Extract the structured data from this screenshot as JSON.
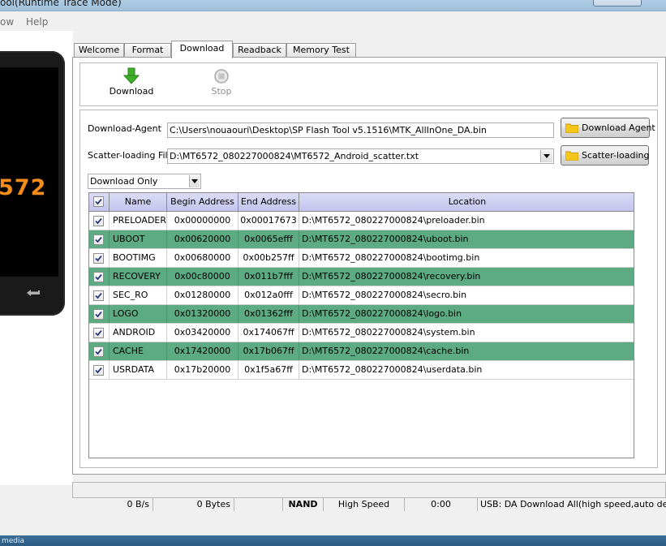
{
  "window": {
    "title": "ool(Runtime Trace Mode)"
  },
  "menu": [
    "ow",
    "Help"
  ],
  "phone": {
    "model_text": "572",
    "back_icon": "back-arrow-icon"
  },
  "tabs": [
    "Welcome",
    "Format",
    "Download",
    "Readback",
    "Memory Test"
  ],
  "active_tab": "Download",
  "toolbar": {
    "download_label": "Download",
    "stop_label": "Stop"
  },
  "download_agent": {
    "label": "Download-Agent",
    "path": "C:\\Users\\nouaouri\\Desktop\\SP Flash Tool v5.1516\\MTK_AllInOne_DA.bin",
    "button_label": "Download Agent"
  },
  "scatter": {
    "label": "Scatter-loading File",
    "path": "D:\\MT6572_080227000824\\MT6572_Android_scatter.txt",
    "button_label": "Scatter-loading"
  },
  "mode": {
    "selected": "Download Only"
  },
  "table": {
    "columns": [
      "Name",
      "Begin Address",
      "End Address",
      "Location"
    ],
    "rows": [
      {
        "checked": true,
        "name": "PRELOADER",
        "begin": "0x00000000",
        "end": "0x00017673",
        "location": "D:\\MT6572_080227000824\\preloader.bin",
        "highlight": false
      },
      {
        "checked": true,
        "name": "UBOOT",
        "begin": "0x00620000",
        "end": "0x0065efff",
        "location": "D:\\MT6572_080227000824\\uboot.bin",
        "highlight": true
      },
      {
        "checked": true,
        "name": "BOOTIMG",
        "begin": "0x00680000",
        "end": "0x00b257ff",
        "location": "D:\\MT6572_080227000824\\bootimg.bin",
        "highlight": false
      },
      {
        "checked": true,
        "name": "RECOVERY",
        "begin": "0x00c80000",
        "end": "0x011b7fff",
        "location": "D:\\MT6572_080227000824\\recovery.bin",
        "highlight": true
      },
      {
        "checked": true,
        "name": "SEC_RO",
        "begin": "0x01280000",
        "end": "0x012a0fff",
        "location": "D:\\MT6572_080227000824\\secro.bin",
        "highlight": false
      },
      {
        "checked": true,
        "name": "LOGO",
        "begin": "0x01320000",
        "end": "0x01362fff",
        "location": "D:\\MT6572_080227000824\\logo.bin",
        "highlight": true
      },
      {
        "checked": true,
        "name": "ANDROID",
        "begin": "0x03420000",
        "end": "0x174067ff",
        "location": "D:\\MT6572_080227000824\\system.bin",
        "highlight": false
      },
      {
        "checked": true,
        "name": "CACHE",
        "begin": "0x17420000",
        "end": "0x17b067ff",
        "location": "D:\\MT6572_080227000824\\cache.bin",
        "highlight": true
      },
      {
        "checked": true,
        "name": "USRDATA",
        "begin": "0x17b20000",
        "end": "0x1f5a67ff",
        "location": "D:\\MT6572_080227000824\\userdata.bin",
        "highlight": false
      }
    ]
  },
  "status": {
    "speed": "0 B/s",
    "bytes": "0 Bytes",
    "storage": "NAND",
    "usb_speed": "High Speed",
    "time": "0:00",
    "message": "USB: DA Download All(high speed,auto detect)"
  },
  "taskbar": {
    "text": "media"
  },
  "colors": {
    "highlight_row": "#5dab83",
    "header": "#c8c8f0",
    "download_arrow": "#3fae2a",
    "phone_text": "#f38c1a"
  }
}
